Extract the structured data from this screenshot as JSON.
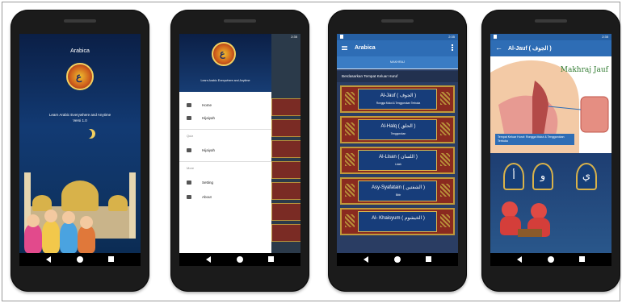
{
  "screen1": {
    "title": "Arabica",
    "tagline": "Learn Arabic Everywhere and Anytime",
    "version": "Versi 1.0"
  },
  "screen2": {
    "header_tagline": "Learn Arabic Everywhere and Anytime",
    "menu": {
      "home": "Home",
      "hijaiyah": "Hijaiyah",
      "section_quiz": "Quiz",
      "quiz_hijaiyah": "Hijaiyah",
      "section_more": "More",
      "setting": "Setting",
      "about": "About"
    }
  },
  "screen3": {
    "app_title": "Arabica",
    "tab": "MAKHRAJ",
    "section_title": "Berdasarkan Tempat Keluar Huruf",
    "items": [
      {
        "name": "Al-Jauf ( الجوف )",
        "desc": "Rongga Mulut & Tenggorokan Terbuka"
      },
      {
        "name": "Al-Halq ( الحلق )",
        "desc": "Tenggorokan"
      },
      {
        "name": "Al-Lisan ( اللسان )",
        "desc": "Lidah"
      },
      {
        "name": "Asy-Syafatain ( الشفتين )",
        "desc": "Bibir"
      },
      {
        "name": "Al- Khaisyum ( الخيشوم )",
        "desc": ""
      }
    ]
  },
  "screen4": {
    "app_title": "Al-Jauf ( الجوف )",
    "diagram_label": "Makhraj Jauf",
    "caption": "Tempat Keluar Huruf: Rongga Mulut & Tenggorokan Terbuka",
    "letters": [
      "أ",
      "و",
      "ي"
    ]
  },
  "status": {
    "time": "2:35"
  }
}
